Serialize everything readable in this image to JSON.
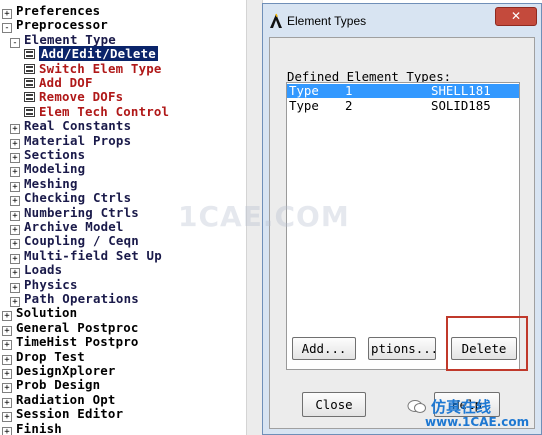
{
  "tree": {
    "items": [
      {
        "label": "Preferences",
        "toggle": "+",
        "style": "dark",
        "indent": 0
      },
      {
        "label": "Preprocessor",
        "toggle": "-",
        "style": "dark",
        "indent": 0
      },
      {
        "label": "Element Type",
        "toggle": "-",
        "style": "normal",
        "indent": 1
      },
      {
        "label": "Add/Edit/Delete",
        "toggle": "",
        "style": "selected",
        "indent": 2
      },
      {
        "label": "Switch Elem Type",
        "toggle": "",
        "style": "red",
        "indent": 2
      },
      {
        "label": "Add DOF",
        "toggle": "",
        "style": "red",
        "indent": 2
      },
      {
        "label": "Remove DOFs",
        "toggle": "",
        "style": "red",
        "indent": 2
      },
      {
        "label": "Elem Tech Control",
        "toggle": "",
        "style": "red",
        "indent": 2
      },
      {
        "label": "Real Constants",
        "toggle": "+",
        "style": "normal",
        "indent": 1
      },
      {
        "label": "Material Props",
        "toggle": "+",
        "style": "normal",
        "indent": 1
      },
      {
        "label": "Sections",
        "toggle": "+",
        "style": "normal",
        "indent": 1
      },
      {
        "label": "Modeling",
        "toggle": "+",
        "style": "normal",
        "indent": 1
      },
      {
        "label": "Meshing",
        "toggle": "+",
        "style": "normal",
        "indent": 1
      },
      {
        "label": "Checking Ctrls",
        "toggle": "+",
        "style": "normal",
        "indent": 1
      },
      {
        "label": "Numbering Ctrls",
        "toggle": "+",
        "style": "normal",
        "indent": 1
      },
      {
        "label": "Archive Model",
        "toggle": "+",
        "style": "normal",
        "indent": 1
      },
      {
        "label": "Coupling / Ceqn",
        "toggle": "+",
        "style": "normal",
        "indent": 1
      },
      {
        "label": "Multi-field Set Up",
        "toggle": "+",
        "style": "normal",
        "indent": 1
      },
      {
        "label": "Loads",
        "toggle": "+",
        "style": "normal",
        "indent": 1
      },
      {
        "label": "Physics",
        "toggle": "+",
        "style": "normal",
        "indent": 1
      },
      {
        "label": "Path Operations",
        "toggle": "+",
        "style": "normal",
        "indent": 1
      },
      {
        "label": "Solution",
        "toggle": "+",
        "style": "dark",
        "indent": 0
      },
      {
        "label": "General Postproc",
        "toggle": "+",
        "style": "dark",
        "indent": 0
      },
      {
        "label": "TimeHist Postpro",
        "toggle": "+",
        "style": "dark",
        "indent": 0
      },
      {
        "label": "Drop Test",
        "toggle": "+",
        "style": "dark",
        "indent": 0
      },
      {
        "label": "DesignXplorer",
        "toggle": "+",
        "style": "dark",
        "indent": 0
      },
      {
        "label": "Prob Design",
        "toggle": "+",
        "style": "dark",
        "indent": 0
      },
      {
        "label": "Radiation Opt",
        "toggle": "+",
        "style": "dark",
        "indent": 0
      },
      {
        "label": "Session Editor",
        "toggle": "+",
        "style": "dark",
        "indent": 0
      },
      {
        "label": "Finish",
        "toggle": "+",
        "style": "dark",
        "indent": 0
      }
    ]
  },
  "dialog": {
    "title": "Element Types",
    "close_glyph": "✕",
    "defined_label": "Defined Element Types:",
    "types": [
      {
        "col1": "Type",
        "col2": "1",
        "col3": "SHELL181",
        "selected": true
      },
      {
        "col1": "Type",
        "col2": "2",
        "col3": "SOLID185",
        "selected": false
      }
    ],
    "buttons": {
      "add": "Add...",
      "options": "ptions...",
      "delete": "Delete",
      "close": "Close",
      "help": "Help"
    }
  },
  "watermark": {
    "center_text": "1CAE.COM",
    "brand_cn": "仿真在线",
    "brand_url": "www.1CAE.com"
  },
  "colors": {
    "selection_navy": "#0a246a",
    "list_selection_blue": "#3399ff",
    "red_item": "#b01818",
    "highlight_box": "#c0392b",
    "close_red": "#c44a3c",
    "dialog_frame": "#d8e4f2"
  }
}
